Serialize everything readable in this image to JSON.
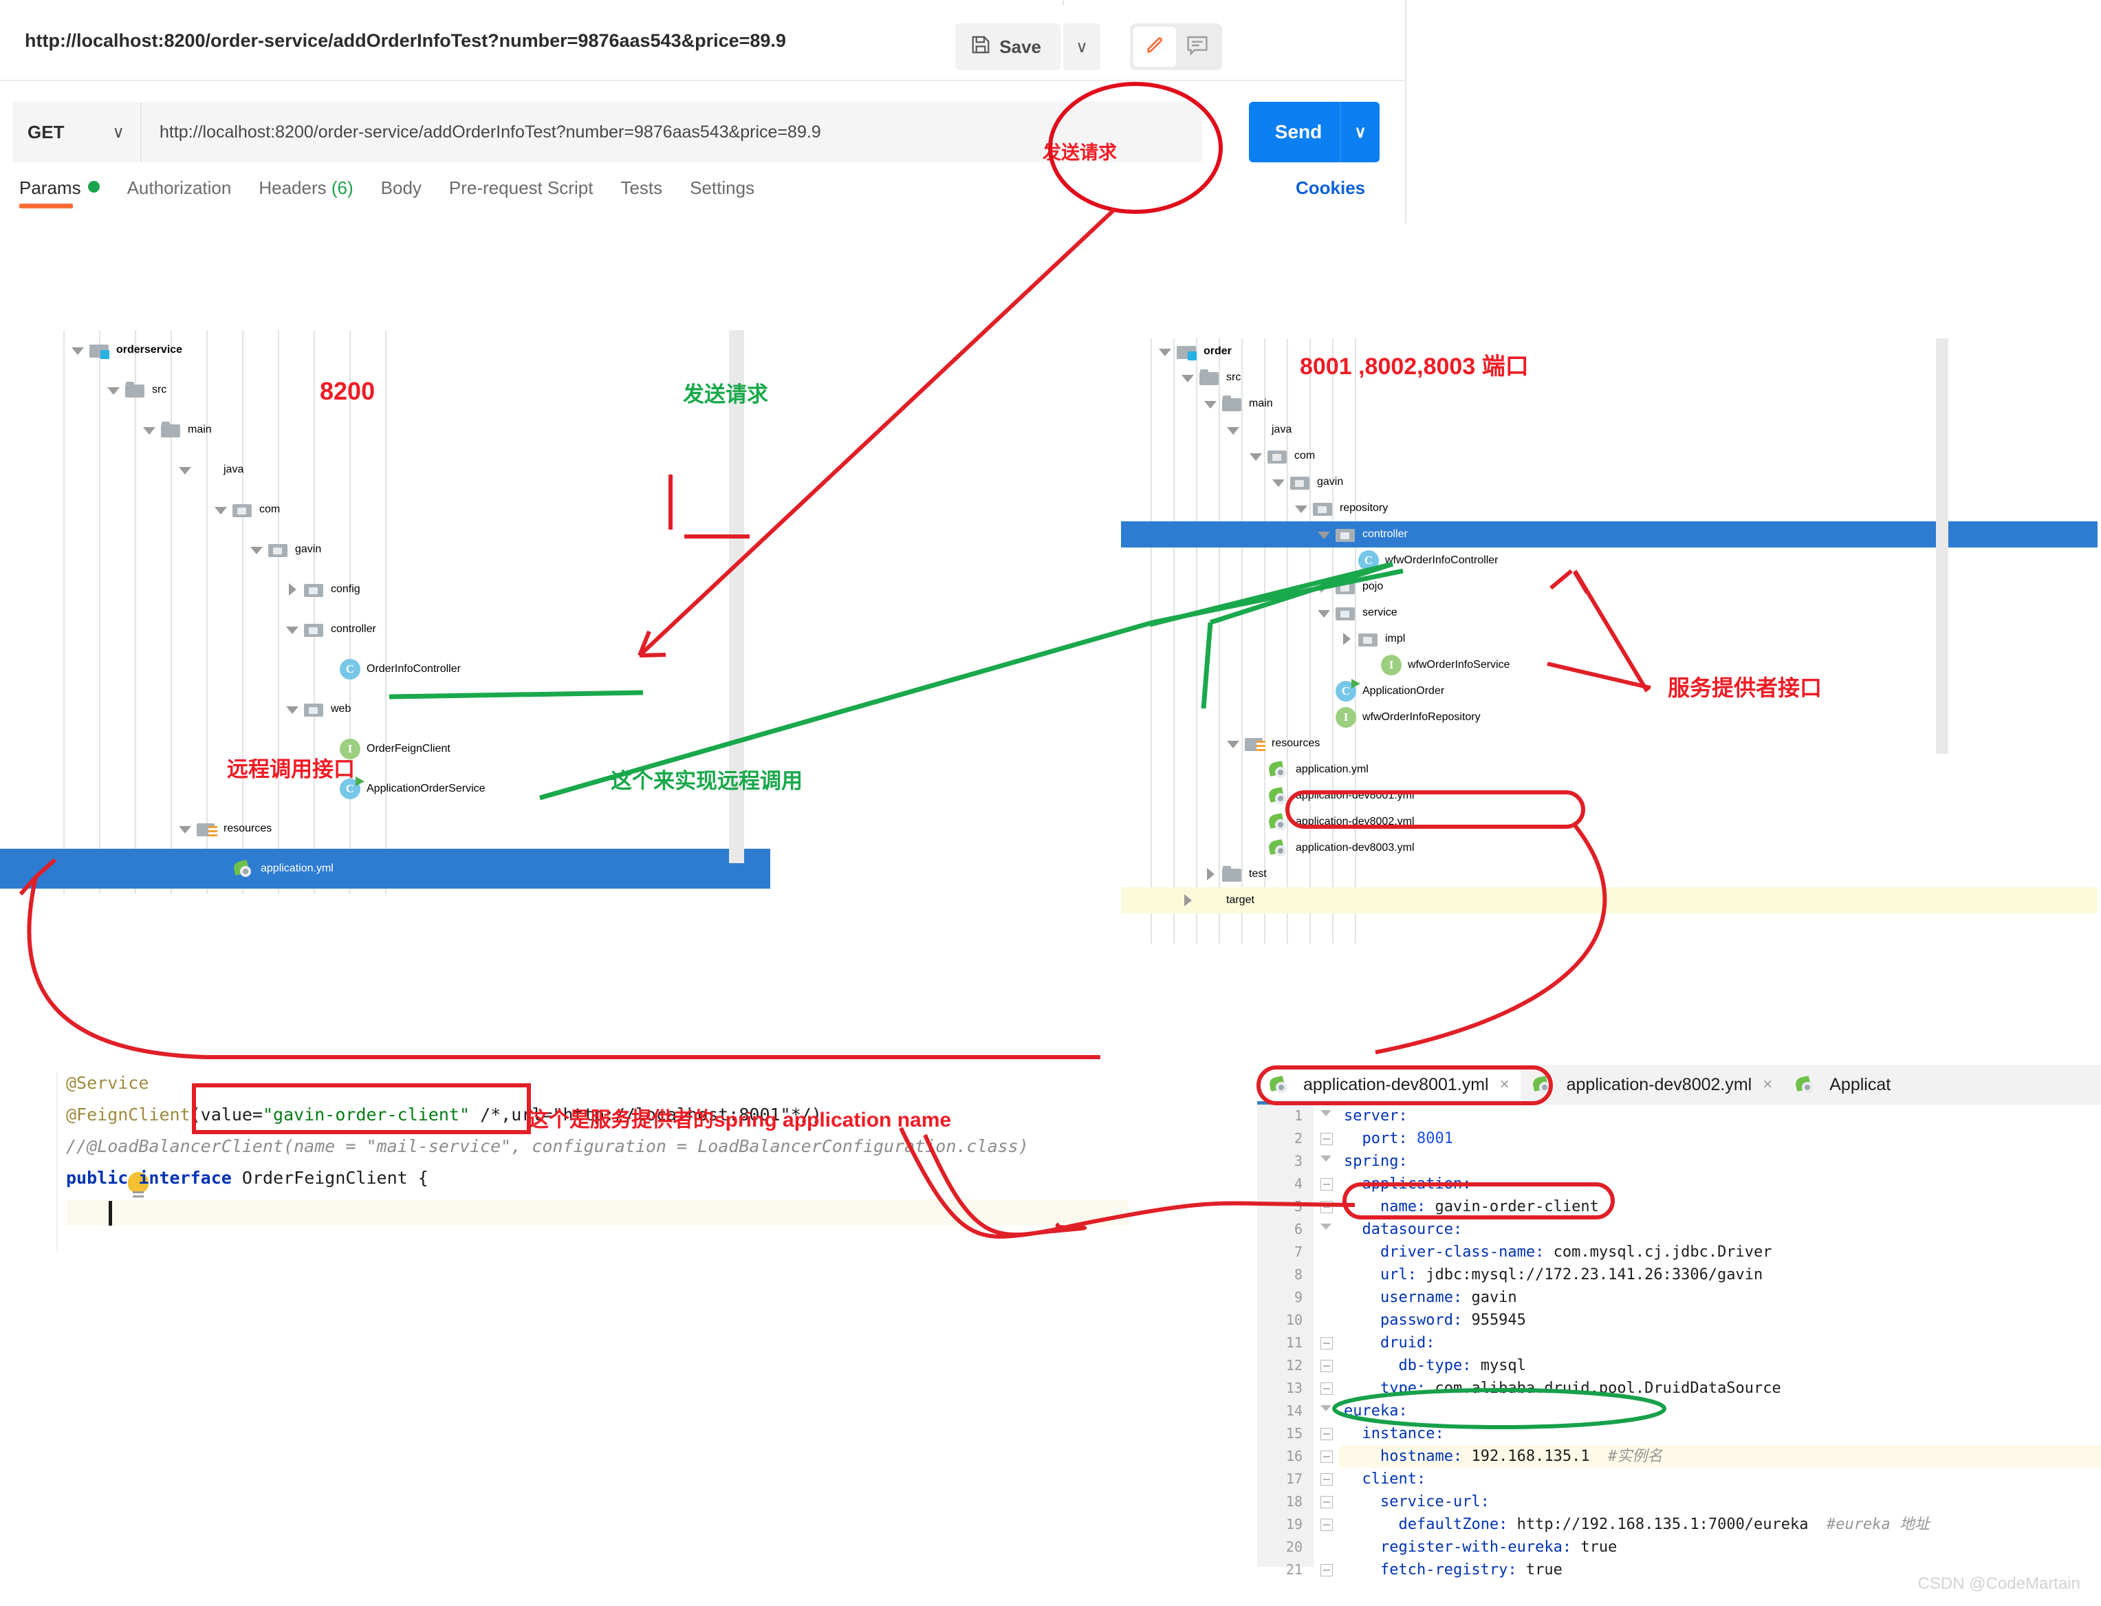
{
  "postman": {
    "request_title": "http://localhost:8200/order-service/addOrderInfoTest?number=9876aas543&price=89.9",
    "save_label": "Save",
    "save_caret": "∨",
    "method": "GET",
    "method_caret": "∨",
    "url_value": "http://localhost:8200/order-service/addOrderInfoTest?number=9876aas543&price=89.9",
    "send_label": "Send",
    "send_caret": "∨",
    "cookies_label": "Cookies",
    "tabs": [
      {
        "label": "Params",
        "badge": "dot",
        "active": true
      },
      {
        "label": "Authorization",
        "badge": "",
        "active": false
      },
      {
        "label": "Headers",
        "badge": "(6)",
        "active": false
      },
      {
        "label": "Body",
        "badge": "",
        "active": false
      },
      {
        "label": "Pre-request Script",
        "badge": "",
        "active": false
      },
      {
        "label": "Tests",
        "badge": "",
        "active": false
      },
      {
        "label": "Settings",
        "badge": "",
        "active": false
      }
    ]
  },
  "left_tree": {
    "rows": [
      {
        "label": "orderservice",
        "depth": 1,
        "arrow": "down",
        "icon": "module",
        "bold": true
      },
      {
        "label": "src",
        "depth": 2,
        "arrow": "down",
        "icon": "folder"
      },
      {
        "label": "main",
        "depth": 3,
        "arrow": "down",
        "icon": "folder"
      },
      {
        "label": "java",
        "depth": 4,
        "arrow": "down",
        "icon": "folder-blue"
      },
      {
        "label": "com",
        "depth": 5,
        "arrow": "down",
        "icon": "pkg"
      },
      {
        "label": "gavin",
        "depth": 6,
        "arrow": "down",
        "icon": "pkg"
      },
      {
        "label": "config",
        "depth": 7,
        "arrow": "right",
        "icon": "pkg"
      },
      {
        "label": "controller",
        "depth": 7,
        "arrow": "down",
        "icon": "pkg"
      },
      {
        "label": "OrderInfoController",
        "depth": 8,
        "arrow": "none",
        "icon": "cls"
      },
      {
        "label": "web",
        "depth": 7,
        "arrow": "down",
        "icon": "pkg"
      },
      {
        "label": "OrderFeignClient",
        "depth": 8,
        "arrow": "none",
        "icon": "iface"
      },
      {
        "label": "ApplicationOrderService",
        "depth": 8,
        "arrow": "none",
        "icon": "app"
      },
      {
        "label": "resources",
        "depth": 4,
        "arrow": "down",
        "icon": "res"
      },
      {
        "label": "application.yml",
        "depth": 5,
        "arrow": "none",
        "icon": "yml",
        "selected": true
      }
    ]
  },
  "right_tree": {
    "rows": [
      {
        "label": "order",
        "depth": 1,
        "arrow": "down",
        "icon": "module",
        "bold": true
      },
      {
        "label": "src",
        "depth": 2,
        "arrow": "down",
        "icon": "folder"
      },
      {
        "label": "main",
        "depth": 3,
        "arrow": "down",
        "icon": "folder"
      },
      {
        "label": "java",
        "depth": 4,
        "arrow": "down",
        "icon": "folder-blue"
      },
      {
        "label": "com",
        "depth": 5,
        "arrow": "down",
        "icon": "pkg"
      },
      {
        "label": "gavin",
        "depth": 6,
        "arrow": "down",
        "icon": "pkg"
      },
      {
        "label": "repository",
        "depth": 7,
        "arrow": "down",
        "icon": "pkg"
      },
      {
        "label": "controller",
        "depth": 8,
        "arrow": "down",
        "icon": "pkg",
        "selected": true
      },
      {
        "label": "wfwOrderInfoController",
        "depth": 9,
        "arrow": "none",
        "icon": "cls"
      },
      {
        "label": "pojo",
        "depth": 8,
        "arrow": "right",
        "icon": "pkg"
      },
      {
        "label": "service",
        "depth": 8,
        "arrow": "down",
        "icon": "pkg"
      },
      {
        "label": "impl",
        "depth": 9,
        "arrow": "right",
        "icon": "pkg"
      },
      {
        "label": "wfwOrderInfoService",
        "depth": 10,
        "arrow": "none",
        "icon": "iface"
      },
      {
        "label": "ApplicationOrder",
        "depth": 8,
        "arrow": "none",
        "icon": "app"
      },
      {
        "label": "wfwOrderInfoRepository",
        "depth": 8,
        "arrow": "none",
        "icon": "iface"
      },
      {
        "label": "resources",
        "depth": 4,
        "arrow": "down",
        "icon": "res"
      },
      {
        "label": "application.yml",
        "depth": 5,
        "arrow": "none",
        "icon": "yml"
      },
      {
        "label": "application-dev8001.yml",
        "depth": 5,
        "arrow": "none",
        "icon": "yml"
      },
      {
        "label": "application-dev8002.yml",
        "depth": 5,
        "arrow": "none",
        "icon": "yml"
      },
      {
        "label": "application-dev8003.yml",
        "depth": 5,
        "arrow": "none",
        "icon": "yml"
      },
      {
        "label": "test",
        "depth": 3,
        "arrow": "right",
        "icon": "folder"
      },
      {
        "label": "target",
        "depth": 2,
        "arrow": "right",
        "icon": "folder-orange",
        "highlight": true
      }
    ]
  },
  "annotations": {
    "send_request_red": "发送请求",
    "send_request_green": "发送请求",
    "port_8200": "8200",
    "ports_right": "8001 ,8002,8003  端口",
    "remote_call_interface": "远程调用接口",
    "this_implements_remote_call": "这个来实现远程调用",
    "service_provider_interface": "服务提供者接口",
    "spring_app_name_note": "这个是服务提供者的spring application name"
  },
  "code_editor": {
    "lines": [
      {
        "tokens": [
          {
            "t": "@Service",
            "c": "ann"
          }
        ]
      },
      {
        "tokens": [
          {
            "t": "@FeignClient",
            "c": "ann"
          },
          {
            "t": "(value=",
            "c": "txt"
          },
          {
            "t": "\"gavin-order-client\"",
            "c": "str"
          },
          {
            "t": " /*,url=\"http://localhost:8001\"*/)",
            "c": "txt"
          }
        ]
      },
      {
        "tokens": [
          {
            "t": "//@LoadBalancerClient(name = \"mail-service\", configuration = LoadBalancerConfiguration.class)",
            "c": "cmt"
          }
        ]
      },
      {
        "tokens": [
          {
            "t": "public",
            "c": "kw"
          },
          {
            "t": " ",
            "c": "txt"
          },
          {
            "t": "interface",
            "c": "kw"
          },
          {
            "t": " OrderFeignClient {",
            "c": "txt"
          }
        ]
      }
    ]
  },
  "yaml_editor": {
    "tabs": [
      {
        "label": "application-dev8001.yml",
        "active": true,
        "close": "×"
      },
      {
        "label": "application-dev8002.yml",
        "active": false,
        "close": "×"
      },
      {
        "label": "Applicat",
        "active": false,
        "close": ""
      }
    ],
    "lines": [
      {
        "n": "1",
        "indent": 0,
        "key": "server:",
        "val": "",
        "cmt": "",
        "fold": "tri"
      },
      {
        "n": "2",
        "indent": 2,
        "key": "port:",
        "val": " 8001",
        "cmt": "",
        "fold": "box",
        "numval": true
      },
      {
        "n": "3",
        "indent": 0,
        "key": "spring:",
        "val": "",
        "cmt": "",
        "fold": "tri"
      },
      {
        "n": "4",
        "indent": 2,
        "key": "application:",
        "val": "",
        "cmt": "",
        "fold": "box"
      },
      {
        "n": "5",
        "indent": 4,
        "key": "name:",
        "val": " gavin-order-client",
        "cmt": "",
        "fold": "box"
      },
      {
        "n": "6",
        "indent": 2,
        "key": "datasource:",
        "val": "",
        "cmt": "",
        "fold": "tri"
      },
      {
        "n": "7",
        "indent": 4,
        "key": "driver-class-name:",
        "val": " com.mysql.cj.jdbc.Driver",
        "cmt": "",
        "fold": ""
      },
      {
        "n": "8",
        "indent": 4,
        "key": "url:",
        "val": " jdbc:mysql://172.23.141.26:3306/gavin",
        "cmt": "",
        "fold": ""
      },
      {
        "n": "9",
        "indent": 4,
        "key": "username:",
        "val": " gavin",
        "cmt": "",
        "fold": ""
      },
      {
        "n": "10",
        "indent": 4,
        "key": "password:",
        "val": " 955945",
        "cmt": "",
        "fold": ""
      },
      {
        "n": "11",
        "indent": 4,
        "key": "druid:",
        "val": "",
        "cmt": "",
        "fold": "box"
      },
      {
        "n": "12",
        "indent": 6,
        "key": "db-type:",
        "val": " mysql",
        "cmt": "",
        "fold": "box"
      },
      {
        "n": "13",
        "indent": 4,
        "key": "type:",
        "val": " com.alibaba.druid.pool.DruidDataSource",
        "cmt": "",
        "fold": "box"
      },
      {
        "n": "14",
        "indent": 0,
        "key": "eureka:",
        "val": "",
        "cmt": "",
        "fold": "tri"
      },
      {
        "n": "15",
        "indent": 2,
        "key": "instance:",
        "val": "",
        "cmt": "",
        "fold": "box"
      },
      {
        "n": "16",
        "indent": 4,
        "key": "hostname:",
        "val": " 192.168.135.1",
        "cmt": "  #实例名",
        "fold": "box"
      },
      {
        "n": "17",
        "indent": 2,
        "key": "client:",
        "val": "",
        "cmt": "",
        "fold": "box"
      },
      {
        "n": "18",
        "indent": 4,
        "key": "service-url:",
        "val": "",
        "cmt": "",
        "fold": "box"
      },
      {
        "n": "19",
        "indent": 6,
        "key": "defaultZone:",
        "val": " http://192.168.135.1:7000/eureka",
        "cmt": "  #eureka 地址",
        "fold": "box"
      },
      {
        "n": "20",
        "indent": 4,
        "key": "register-with-eureka:",
        "val": " true",
        "cmt": "",
        "fold": ""
      },
      {
        "n": "21",
        "indent": 4,
        "key": "fetch-registry:",
        "val": " true",
        "cmt": "",
        "fold": "box"
      }
    ]
  },
  "watermark": "CSDN @CodeMartain",
  "colors": {
    "accent_orange": "#ff6c37",
    "send_blue": "#0c7ff2",
    "selection_blue": "#2d7cd1",
    "annotation_red": "#ee1c25",
    "annotation_green": "#18a84a"
  }
}
